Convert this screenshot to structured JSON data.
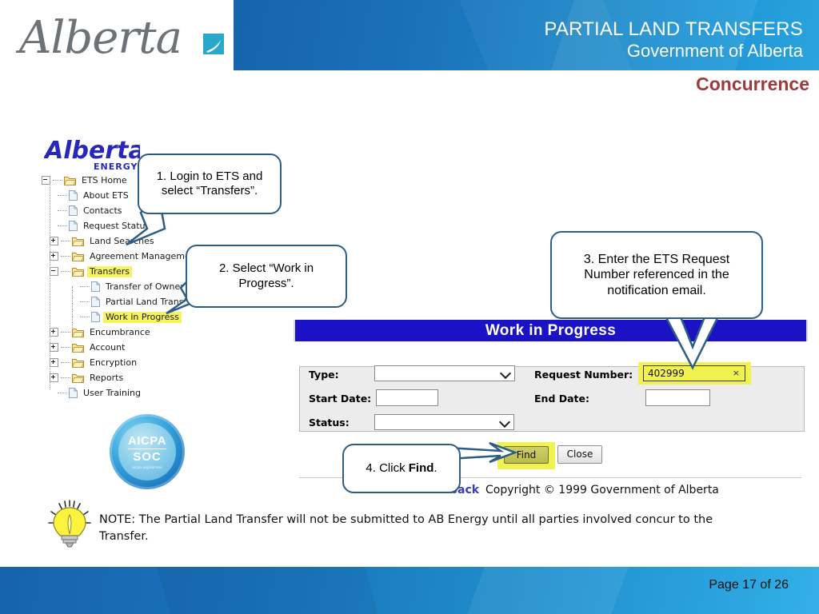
{
  "header": {
    "logo_text": "Alberta",
    "title": "PARTIAL LAND TRANSFERS",
    "subtitle": "Government of Alberta",
    "section": "Concurrence",
    "accent_color": "#1763ad",
    "section_color": "#9c3a3c"
  },
  "ets_logo": {
    "brand": "Alberta",
    "division": "ENERGY"
  },
  "tree": {
    "items": [
      {
        "label": "ETS Home",
        "icon": "folder-icon",
        "indent": 0,
        "toggle": "minus",
        "highlighted": false
      },
      {
        "label": "About ETS",
        "icon": "document-icon",
        "indent": 1,
        "toggle": "none",
        "highlighted": false
      },
      {
        "label": "Contacts",
        "icon": "document-icon",
        "indent": 1,
        "toggle": "none",
        "highlighted": false
      },
      {
        "label": "Request Status",
        "icon": "document-icon",
        "indent": 1,
        "toggle": "none",
        "highlighted": false
      },
      {
        "label": "Land Searches",
        "icon": "folder-icon",
        "indent": 1,
        "toggle": "plus",
        "highlighted": false
      },
      {
        "label": "Agreement Management",
        "icon": "folder-icon",
        "indent": 1,
        "toggle": "plus",
        "highlighted": false
      },
      {
        "label": "Transfers",
        "icon": "folder-icon",
        "indent": 1,
        "toggle": "minus",
        "highlighted": true
      },
      {
        "label": "Transfer of Ownership",
        "icon": "document-icon",
        "indent": 2,
        "toggle": "none",
        "highlighted": false
      },
      {
        "label": "Partial Land Transfer",
        "icon": "document-icon",
        "indent": 2,
        "toggle": "none",
        "highlighted": false
      },
      {
        "label": "Work in Progress",
        "icon": "document-icon",
        "indent": 2,
        "toggle": "none",
        "highlighted": true
      },
      {
        "label": "Encumbrance",
        "icon": "folder-icon",
        "indent": 1,
        "toggle": "plus",
        "highlighted": false
      },
      {
        "label": "Account",
        "icon": "folder-icon",
        "indent": 1,
        "toggle": "plus",
        "highlighted": false
      },
      {
        "label": "Encryption",
        "icon": "folder-icon",
        "indent": 1,
        "toggle": "plus",
        "highlighted": false
      },
      {
        "label": "Reports",
        "icon": "folder-icon",
        "indent": 1,
        "toggle": "plus",
        "highlighted": false
      },
      {
        "label": "User Training",
        "icon": "document-icon",
        "indent": 1,
        "toggle": "none",
        "highlighted": false
      }
    ]
  },
  "callouts": {
    "step1": "1. Login to ETS and select “Transfers”.",
    "step2": "2. Select “Work in Progress”.",
    "step3": "3. Enter the ETS Request Number referenced in the notification email.",
    "step4_prefix": "4. Click ",
    "step4_bold": "Find",
    "step4_suffix": "."
  },
  "wip": {
    "title": "Work in Progress",
    "title_bg": "#1a12c4",
    "labels": {
      "type": "Type:",
      "start_date": "Start Date:",
      "status": "Status:",
      "request_number": "Request Number:",
      "end_date": "End Date:"
    },
    "values": {
      "type": "",
      "start_date": "",
      "status": "",
      "request_number": "402999",
      "end_date": ""
    },
    "request_number_clear": "×",
    "highlight_color": "#f1f150",
    "buttons": {
      "find": "Find",
      "close": "Close"
    },
    "footer": {
      "feedback": "Feedback",
      "copyright": "Copyright © 1999 Government of Alberta"
    }
  },
  "badge": {
    "line1": "AICPA",
    "line2": "SOC",
    "url": "aicpa.org/soc4so"
  },
  "note": {
    "text": "NOTE: The Partial Land Transfer will not be submitted to AB Energy until all parties involved concur to the Transfer."
  },
  "footer": {
    "page_label": "Page 17 of 26"
  }
}
